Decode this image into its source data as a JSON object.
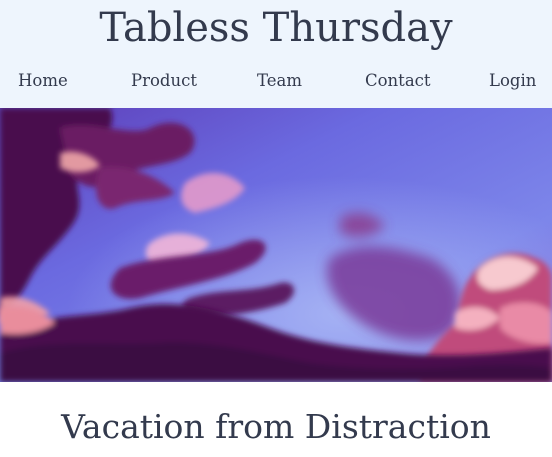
{
  "header": {
    "site_title": "Tabless Thursday",
    "background_color": "#eef5fd"
  },
  "nav": {
    "items": [
      {
        "label": "Home"
      },
      {
        "label": "Product"
      },
      {
        "label": "Team"
      },
      {
        "label": "Contact"
      },
      {
        "label": "Login"
      }
    ]
  },
  "hero": {
    "image_subject": "purple-sunset-clouds-sky",
    "colors": {
      "sky": "#6f6de0",
      "cloud_dark": "#4a0f4e",
      "cloud_mid": "#8a2a78",
      "cloud_glow": "#f2b6c8"
    }
  },
  "main": {
    "section_title": "Vacation from Distraction"
  },
  "colors": {
    "text": "#333a4d"
  }
}
